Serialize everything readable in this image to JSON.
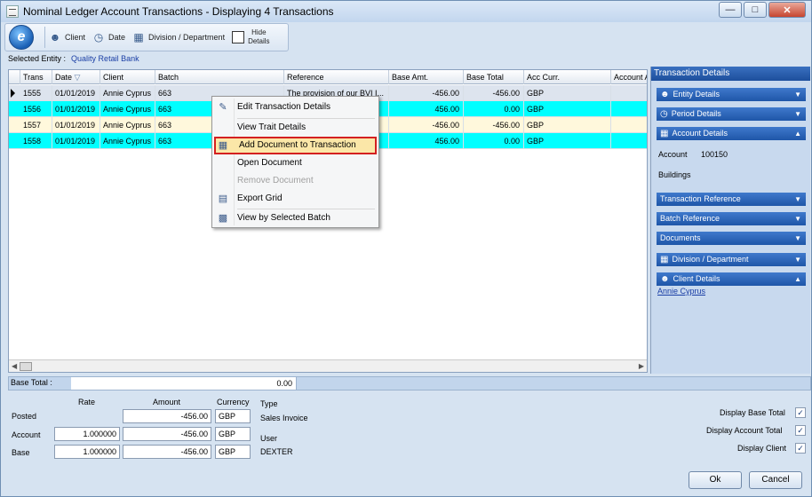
{
  "window": {
    "title": "Nominal Ledger Account Transactions - Displaying 4 Transactions"
  },
  "toolbar": {
    "client": "Client",
    "date": "Date",
    "division": "Division / Department",
    "hide_details_1": "Hide",
    "hide_details_2": "Details"
  },
  "entity": {
    "label": "Selected Entity :",
    "value": "Quality Retail Bank"
  },
  "grid": {
    "columns": [
      "Trans",
      "Date",
      "Client",
      "Batch",
      "Reference",
      "Base Amt.",
      "Base Total",
      "Acc Curr.",
      "Account A"
    ],
    "rows": [
      [
        "1555",
        "01/01/2019",
        "Annie Cyprus",
        "663",
        "The provision of our BVI I...",
        "-456.00",
        "-456.00",
        "GBP"
      ],
      [
        "1556",
        "01/01/2019",
        "Annie Cyprus",
        "663",
        "",
        "456.00",
        "0.00",
        "GBP"
      ],
      [
        "1557",
        "01/01/2019",
        "Annie Cyprus",
        "663",
        "",
        "-456.00",
        "-456.00",
        "GBP"
      ],
      [
        "1558",
        "01/01/2019",
        "Annie Cyprus",
        "663",
        "",
        "456.00",
        "0.00",
        "GBP"
      ]
    ]
  },
  "context_menu": {
    "items": [
      "Edit Transaction Details",
      "View Trait Details",
      "Add Document to Transaction",
      "Open Document",
      "Remove Document",
      "Export Grid",
      "View by Selected Batch"
    ]
  },
  "panel": {
    "title": "Transaction Details",
    "entity_details": "Entity Details",
    "period_details": "Period Details",
    "account_details": "Account Details",
    "account_label": "Account",
    "account_value": "100150",
    "account_name": "Buildings",
    "transaction_reference": "Transaction Reference",
    "batch_reference": "Batch Reference",
    "documents": "Documents",
    "division_department": "Division / Department",
    "client_details": "Client Details",
    "client_link": "Annie Cyprus"
  },
  "base_total": {
    "label": "Base Total :",
    "value": "0.00"
  },
  "form": {
    "rate_hdr": "Rate",
    "amount_hdr": "Amount",
    "currency_hdr": "Currency",
    "type_hdr": "Type",
    "type_value": "Sales Invoice",
    "user_hdr": "User",
    "user_value": "DEXTER",
    "posted_label": "Posted",
    "account_label": "Account",
    "base_label": "Base",
    "posted_amount": "-456.00",
    "posted_currency": "GBP",
    "account_rate": "1.000000",
    "account_amount": "-456.00",
    "account_currency": "GBP",
    "base_rate": "1.000000",
    "base_amount": "-456.00",
    "base_currency": "GBP"
  },
  "options": {
    "display_base_total": "Display Base Total",
    "display_account_total": "Display Account Total",
    "display_client": "Display Client",
    "check_mark": "✓"
  },
  "buttons": {
    "ok": "Ok",
    "cancel": "Cancel"
  }
}
